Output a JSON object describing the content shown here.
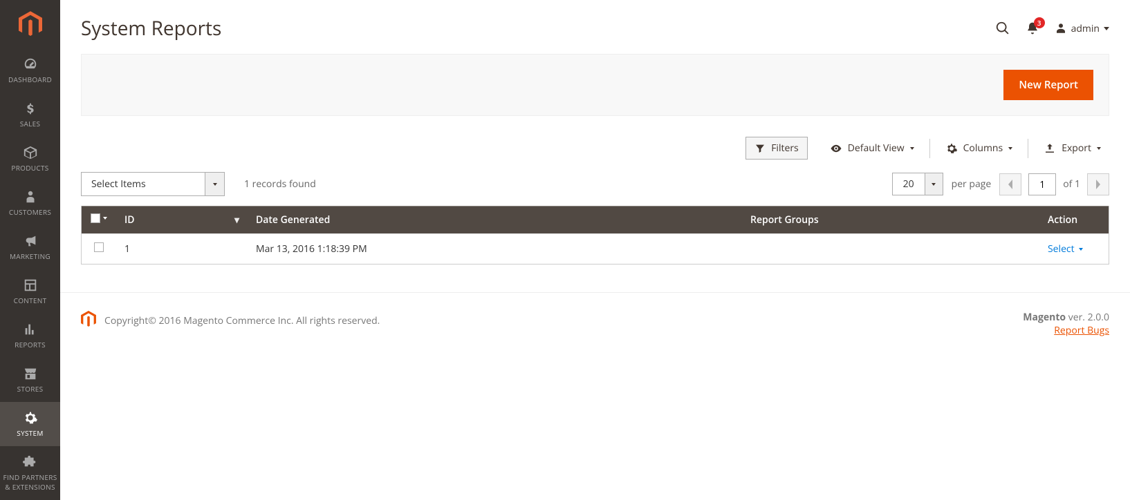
{
  "sidebar": {
    "items": [
      {
        "label": "DASHBOARD"
      },
      {
        "label": "SALES"
      },
      {
        "label": "PRODUCTS"
      },
      {
        "label": "CUSTOMERS"
      },
      {
        "label": "MARKETING"
      },
      {
        "label": "CONTENT"
      },
      {
        "label": "REPORTS"
      },
      {
        "label": "STORES"
      },
      {
        "label": "SYSTEM"
      },
      {
        "label": "FIND PARTNERS & EXTENSIONS"
      }
    ]
  },
  "header": {
    "title": "System Reports",
    "notifications_count": "3",
    "user_label": "admin"
  },
  "actions": {
    "new_report": "New Report"
  },
  "controls": {
    "filters": "Filters",
    "default_view": "Default View",
    "columns": "Columns",
    "export": "Export"
  },
  "toolbar": {
    "select_items": "Select Items",
    "records_found": "1 records found",
    "per_page_value": "20",
    "per_page_label": "per page",
    "page_value": "1",
    "page_of": "of 1"
  },
  "table": {
    "headers": {
      "id": "ID",
      "date": "Date Generated",
      "groups": "Report Groups",
      "action": "Action"
    },
    "rows": [
      {
        "id": "1",
        "date": "Mar 13, 2016 1:18:39 PM",
        "groups": "",
        "action": "Select"
      }
    ]
  },
  "footer": {
    "copyright": "Copyright© 2016 Magento Commerce Inc. All rights reserved.",
    "version_label": "Magento",
    "version": " ver. 2.0.0",
    "report_bugs": "Report Bugs"
  }
}
